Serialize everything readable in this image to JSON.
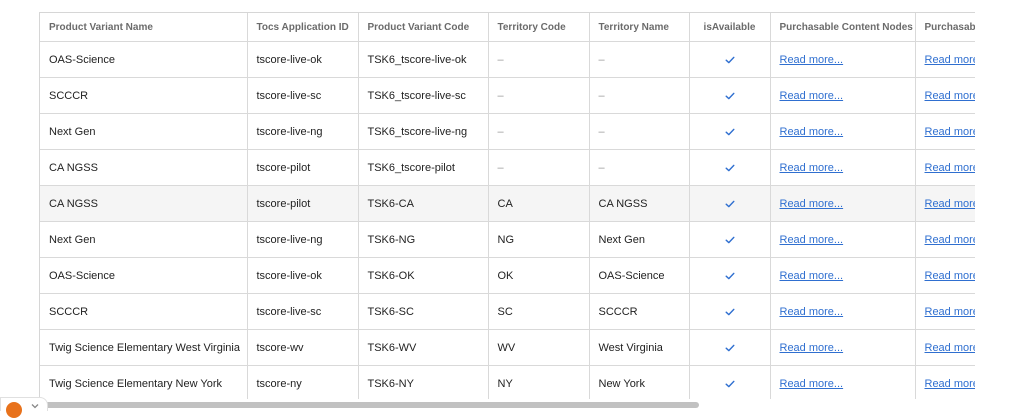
{
  "table": {
    "columns": [
      "Product Variant Name",
      "Tocs Application ID",
      "Product Variant Code",
      "Territory Code",
      "Territory Name",
      "isAvailable",
      "Purchasable Content Nodes",
      "Purchasab"
    ],
    "read_more_label": "Read more...",
    "empty_value": "–",
    "rows": [
      {
        "name": "OAS-Science",
        "app_id": "tscore-live-ok",
        "code": "TSK6_tscore-live-ok",
        "territory_code": "–",
        "territory_name": "–"
      },
      {
        "name": "SCCCR",
        "app_id": "tscore-live-sc",
        "code": "TSK6_tscore-live-sc",
        "territory_code": "–",
        "territory_name": "–"
      },
      {
        "name": "Next Gen",
        "app_id": "tscore-live-ng",
        "code": "TSK6_tscore-live-ng",
        "territory_code": "–",
        "territory_name": "–"
      },
      {
        "name": "CA NGSS",
        "app_id": "tscore-pilot",
        "code": "TSK6_tscore-pilot",
        "territory_code": "–",
        "territory_name": "–"
      },
      {
        "name": "CA NGSS",
        "app_id": "tscore-pilot",
        "code": "TSK6-CA",
        "territory_code": "CA",
        "territory_name": "CA NGSS"
      },
      {
        "name": "Next Gen",
        "app_id": "tscore-live-ng",
        "code": "TSK6-NG",
        "territory_code": "NG",
        "territory_name": "Next Gen"
      },
      {
        "name": "OAS-Science",
        "app_id": "tscore-live-ok",
        "code": "TSK6-OK",
        "territory_code": "OK",
        "territory_name": "OAS-Science"
      },
      {
        "name": "SCCCR",
        "app_id": "tscore-live-sc",
        "code": "TSK6-SC",
        "territory_code": "SC",
        "territory_name": "SCCCR"
      },
      {
        "name": "Twig Science Elementary West Virginia",
        "app_id": "tscore-wv",
        "code": "TSK6-WV",
        "territory_code": "WV",
        "territory_name": "West Virginia"
      },
      {
        "name": "Twig Science Elementary New York",
        "app_id": "tscore-ny",
        "code": "TSK6-NY",
        "territory_code": "NY",
        "territory_name": "New York"
      }
    ]
  },
  "colors": {
    "link": "#2f6fd0",
    "check": "#2f6fd0",
    "avatar": "#e8721c"
  },
  "icons": {
    "available": "check-icon",
    "avatar": "user-avatar",
    "expand": "chevron-down-icon"
  }
}
